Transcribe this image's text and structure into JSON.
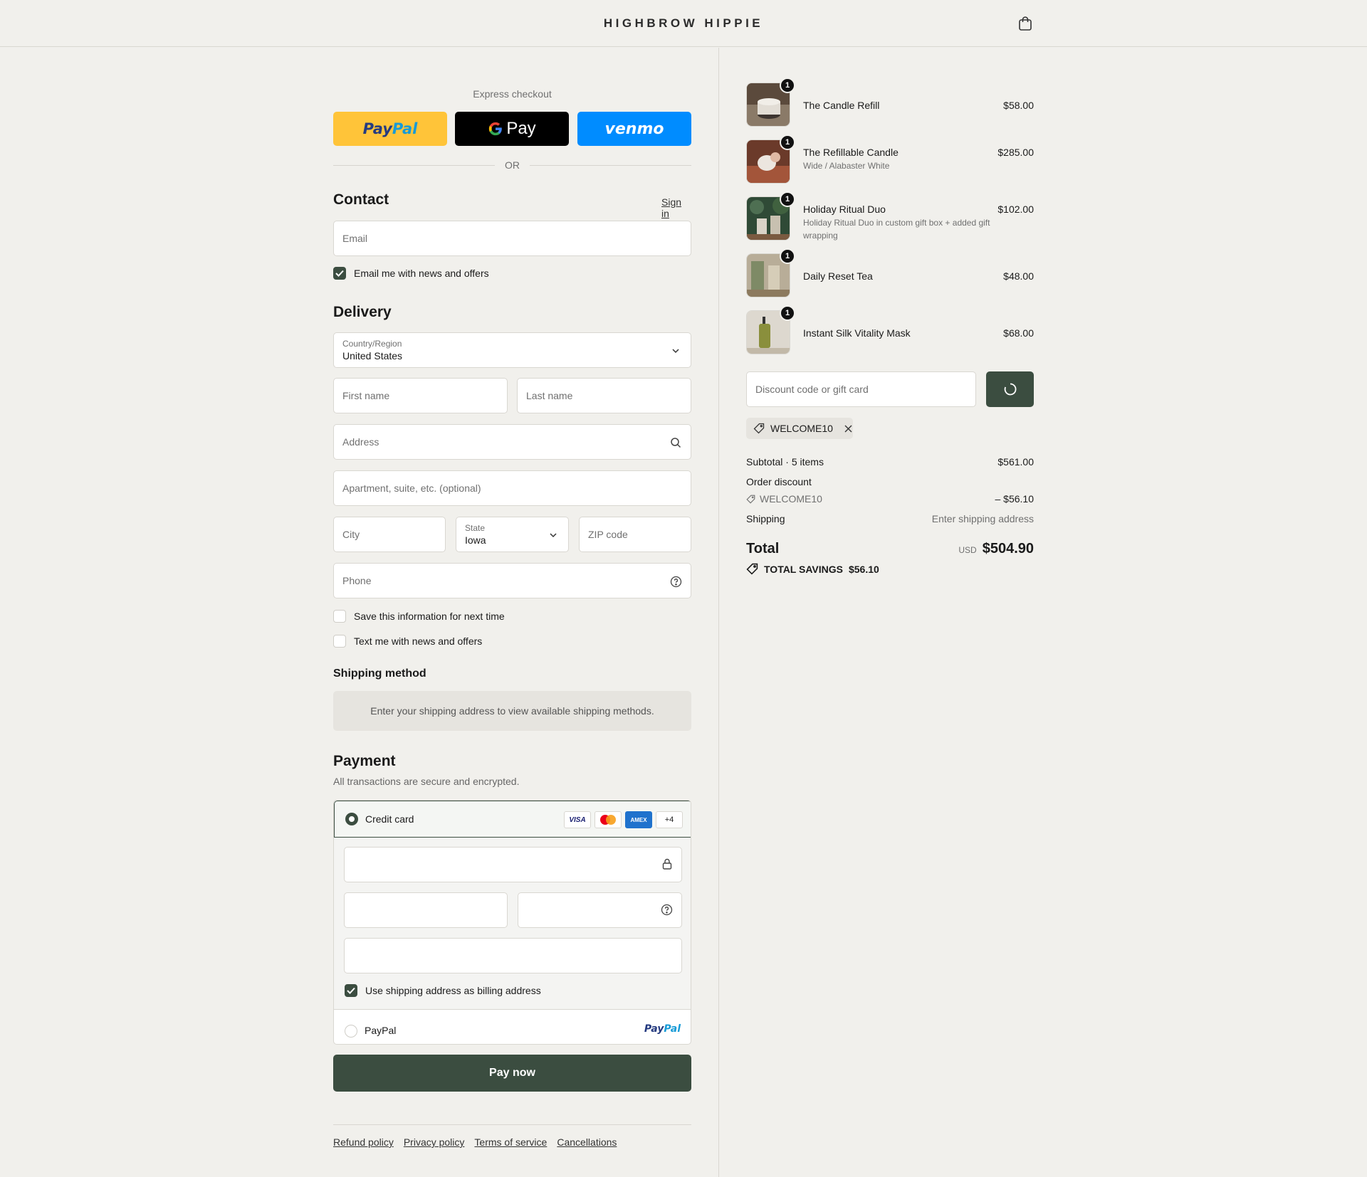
{
  "header": {
    "brand": "HIGHBROW HIPPIE",
    "cart_icon": "shopping-bag-icon"
  },
  "express": {
    "title": "Express checkout",
    "paypal_part1": "Pay",
    "paypal_part2": "Pal",
    "gpay_g": "G",
    "gpay_label": "Pay",
    "venmo_label": "venmo",
    "or_label": "OR"
  },
  "contact": {
    "title": "Contact",
    "sign_in": "Sign in",
    "email_placeholder": "Email",
    "news_label": "Email me with news and offers",
    "news_checked": true
  },
  "delivery": {
    "title": "Delivery",
    "country_label": "Country/Region",
    "country_value": "United States",
    "first_name_placeholder": "First name",
    "last_name_placeholder": "Last name",
    "address_placeholder": "Address",
    "apartment_placeholder": "Apartment, suite, etc. (optional)",
    "city_placeholder": "City",
    "state_label": "State",
    "state_value": "Iowa",
    "zip_placeholder": "ZIP code",
    "phone_placeholder": "Phone",
    "save_info_label": "Save this information for next time",
    "text_me_label": "Text me with news and offers"
  },
  "shipping_method": {
    "title": "Shipping method",
    "notice": "Enter your shipping address to view available shipping methods."
  },
  "payment": {
    "title": "Payment",
    "subtitle": "All transactions are secure and encrypted.",
    "credit_card_label": "Credit card",
    "card_logos": [
      "VISA",
      "MC",
      "AMEX",
      "+4"
    ],
    "billing_label": "Use shipping address as billing address",
    "billing_checked": true,
    "paypal_label": "PayPal",
    "paypal_logo_part1": "Pay",
    "paypal_logo_part2": "Pal"
  },
  "pay_now_label": "Pay now",
  "footer": {
    "links": [
      "Refund policy",
      "Privacy policy",
      "Terms of service",
      "Cancellations"
    ]
  },
  "order": {
    "items": [
      {
        "name": "The Candle Refill",
        "variant": "",
        "price": "$58.00",
        "quantity": "1"
      },
      {
        "name": "The Refillable Candle",
        "variant": "Wide / Alabaster White",
        "price": "$285.00",
        "quantity": "1"
      },
      {
        "name": "Holiday Ritual Duo",
        "variant": "Holiday Ritual Duo in custom gift box + added gift wrapping",
        "price": "$102.00",
        "quantity": "1"
      },
      {
        "name": "Daily Reset Tea",
        "variant": "",
        "price": "$48.00",
        "quantity": "1"
      },
      {
        "name": "Instant Silk Vitality Mask",
        "variant": "",
        "price": "$68.00",
        "quantity": "1"
      }
    ],
    "discount_placeholder": "Discount code or gift card",
    "applied_code": "WELCOME10",
    "subtotal_label": "Subtotal · 5 items",
    "subtotal_value": "$561.00",
    "order_discount_label": "Order discount",
    "discount_code": "WELCOME10",
    "discount_value": "– $56.10",
    "shipping_label": "Shipping",
    "shipping_value": "Enter shipping address",
    "total_label": "Total",
    "currency": "USD",
    "total_value": "$504.90",
    "savings_label": "TOTAL SAVINGS",
    "savings_value": "$56.10"
  },
  "colors": {
    "accent": "#3b4d40",
    "background": "#f1f0ec",
    "paypal": "#ffc439",
    "venmo": "#008cff"
  }
}
